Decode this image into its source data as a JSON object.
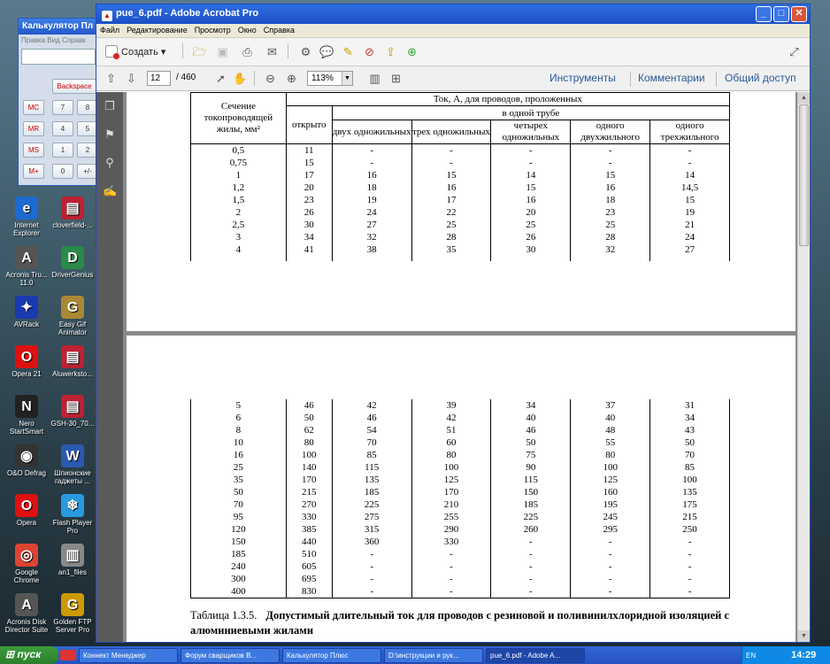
{
  "desktop": {
    "icons": [
      {
        "label": "Internet Explorer",
        "glyph": "e",
        "color": "#1d6ad0"
      },
      {
        "label": "cloverfield-...",
        "glyph": "▤",
        "color": "#b23"
      },
      {
        "label": "Acronis Tru... 11.0",
        "glyph": "A",
        "color": "#555"
      },
      {
        "label": "DriverGenius",
        "glyph": "D",
        "color": "#2a8a4a"
      },
      {
        "label": "AVRack",
        "glyph": "✦",
        "color": "#1a3ab0"
      },
      {
        "label": "Easy Gif Animator",
        "glyph": "G",
        "color": "#a83"
      },
      {
        "label": "Opera 21",
        "glyph": "O",
        "color": "#d11"
      },
      {
        "label": "Aluwerkstо...",
        "glyph": "▤",
        "color": "#b23"
      },
      {
        "label": "Nero StartSmart",
        "glyph": "N",
        "color": "#222"
      },
      {
        "label": "GSH-30_70...",
        "glyph": "▤",
        "color": "#b23"
      },
      {
        "label": "O&O Defrag",
        "glyph": "◉",
        "color": "#333"
      },
      {
        "label": "Шпионские гаджеты ...",
        "glyph": "W",
        "color": "#2a5ab0"
      },
      {
        "label": "Opera",
        "glyph": "O",
        "color": "#d11"
      },
      {
        "label": "Flash Player Pro",
        "glyph": "❄",
        "color": "#2a9ae0"
      },
      {
        "label": "Google Chrome",
        "glyph": "◎",
        "color": "#d43"
      },
      {
        "label": "an1_files",
        "glyph": "▥",
        "color": "#888"
      },
      {
        "label": "Acronis Disk Director Suite",
        "glyph": "A",
        "color": "#555"
      },
      {
        "label": "Golden FTP Server Pro",
        "glyph": "G",
        "color": "#c90"
      }
    ]
  },
  "calc": {
    "title": "Калькулятор Пл",
    "menu": "Правка  Вид  Справк",
    "buttons": [
      "Backspace",
      "MC",
      "7",
      "8",
      "MR",
      "4",
      "5",
      "MS",
      "1",
      "2",
      "M+",
      "0",
      "+/-"
    ]
  },
  "acrobat": {
    "title": "pue_6.pdf - Adobe Acrobat Pro",
    "menu": [
      "Файл",
      "Редактирование",
      "Просмотр",
      "Окно",
      "Справка"
    ],
    "create": "Создать ▾",
    "page_current": "12",
    "page_total": "/ 460",
    "zoom": "113%",
    "right_nav": [
      "Инструменты",
      "Комментарии",
      "Общий доступ"
    ]
  },
  "table_header": {
    "section": "Сечение токопроводящей жилы, мм²",
    "current": "Ток, А, для проводов, проложенных",
    "in_tube": "в одной трубе",
    "open": "открыто",
    "cols": [
      "двух одножильных",
      "трех одножильных",
      "четырех одножильных",
      "одного двухжильного",
      "одного трехжильного"
    ]
  },
  "rows_page1": [
    [
      "0,5",
      "11",
      "-",
      "-",
      "-",
      "-",
      "-"
    ],
    [
      "0,75",
      "15",
      "-",
      "-",
      "-",
      "-",
      "-"
    ],
    [
      "1",
      "17",
      "16",
      "15",
      "14",
      "15",
      "14"
    ],
    [
      "1,2",
      "20",
      "18",
      "16",
      "15",
      "16",
      "14,5"
    ],
    [
      "1,5",
      "23",
      "19",
      "17",
      "16",
      "18",
      "15"
    ],
    [
      "2",
      "26",
      "24",
      "22",
      "20",
      "23",
      "19"
    ],
    [
      "2,5",
      "30",
      "27",
      "25",
      "25",
      "25",
      "21"
    ],
    [
      "3",
      "34",
      "32",
      "28",
      "26",
      "28",
      "24"
    ],
    [
      "4",
      "41",
      "38",
      "35",
      "30",
      "32",
      "27"
    ]
  ],
  "rows_page2": [
    [
      "5",
      "46",
      "42",
      "39",
      "34",
      "37",
      "31"
    ],
    [
      "6",
      "50",
      "46",
      "42",
      "40",
      "40",
      "34"
    ],
    [
      "8",
      "62",
      "54",
      "51",
      "46",
      "48",
      "43"
    ],
    [
      "10",
      "80",
      "70",
      "60",
      "50",
      "55",
      "50"
    ],
    [
      "16",
      "100",
      "85",
      "80",
      "75",
      "80",
      "70"
    ],
    [
      "25",
      "140",
      "115",
      "100",
      "90",
      "100",
      "85"
    ],
    [
      "35",
      "170",
      "135",
      "125",
      "115",
      "125",
      "100"
    ],
    [
      "50",
      "215",
      "185",
      "170",
      "150",
      "160",
      "135"
    ],
    [
      "70",
      "270",
      "225",
      "210",
      "185",
      "195",
      "175"
    ],
    [
      "95",
      "330",
      "275",
      "255",
      "225",
      "245",
      "215"
    ],
    [
      "120",
      "385",
      "315",
      "290",
      "260",
      "295",
      "250"
    ],
    [
      "150",
      "440",
      "360",
      "330",
      "-",
      "-",
      "-"
    ],
    [
      "185",
      "510",
      "-",
      "-",
      "-",
      "-",
      "-"
    ],
    [
      "240",
      "605",
      "-",
      "-",
      "-",
      "-",
      "-"
    ],
    [
      "300",
      "695",
      "-",
      "-",
      "-",
      "-",
      "-"
    ],
    [
      "400",
      "830",
      "-",
      "-",
      "-",
      "-",
      "-"
    ]
  ],
  "caption_label": "Таблица   1.3.5.",
  "caption_text": "Допустимый   длительный   ток   для   проводов   с   резиновой   и поливинилхлоридной изоляцией с алюминиевыми жилами",
  "taskbar": {
    "start": "пуск",
    "items": [
      "Коннект Менеджер",
      "Форум сварщиков В...",
      "Калькулятор Плюс",
      "D:\\инструкции и рук...",
      "pue_6.pdf - Adobe A..."
    ],
    "lang": "EN",
    "time": "14:29"
  }
}
